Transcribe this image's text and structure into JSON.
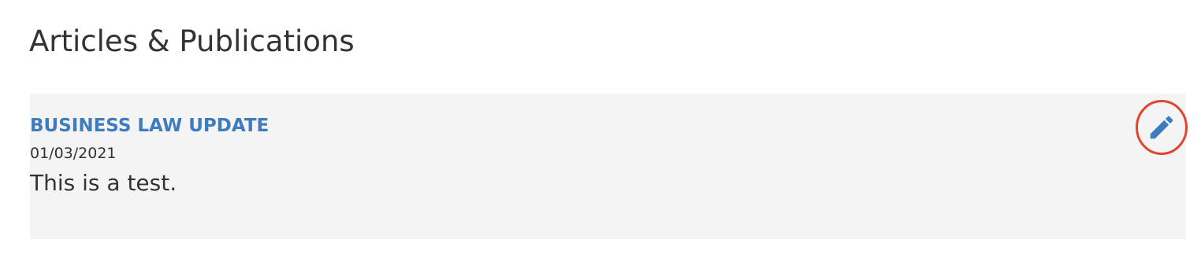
{
  "section": {
    "title": "Articles & Publications"
  },
  "articles": [
    {
      "title": "BUSINESS LAW UPDATE",
      "date": "01/03/2021",
      "body": "This is a test.",
      "edit_icon": "pencil-icon",
      "edit_highlight_color": "#e0462f"
    }
  ],
  "colors": {
    "link": "#3f7bbf",
    "text": "#333333",
    "card_background": "#f4f4f4",
    "highlight": "#e0462f"
  }
}
